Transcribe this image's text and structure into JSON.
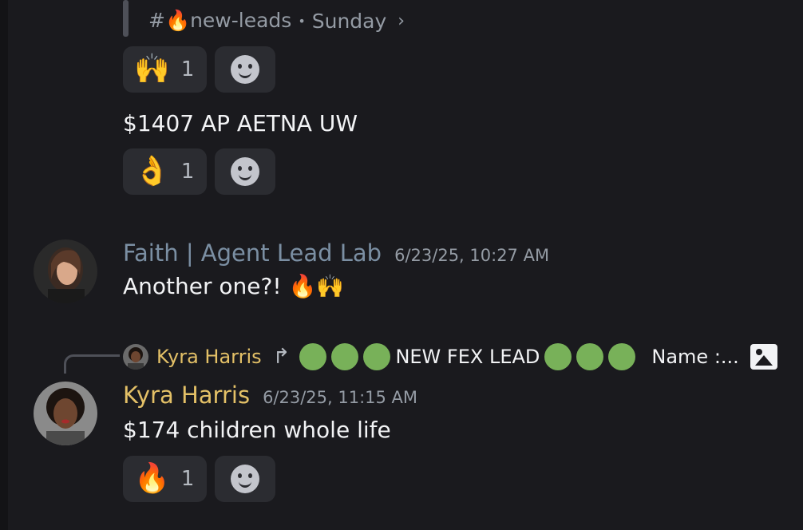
{
  "forwarded": {
    "channel": "#🔥new-leads",
    "separator": "•",
    "day": "Sunday",
    "chevron": "›"
  },
  "reactions_top": {
    "emoji": "🙌",
    "count": "1"
  },
  "message_top": {
    "text": "$1407 AP AETNA UW"
  },
  "reactions_ok": {
    "emoji": "👌",
    "count": "1"
  },
  "faith_message": {
    "author": "Faith | Agent Lead Lab",
    "author_color": "#7b8fa3",
    "timestamp": "6/23/25, 10:27 AM",
    "text": "Another one?! 🔥🙌"
  },
  "reply": {
    "author": "Kyra Harris",
    "arrow": "↱",
    "text": "NEW FEX LEAD",
    "tail": "Name :...",
    "dot_color": "#78b159"
  },
  "kyra_message": {
    "author": "Kyra Harris",
    "author_color": "#e3c067",
    "timestamp": "6/23/25, 11:15 AM",
    "text": "$174 children whole life"
  },
  "reactions_fire": {
    "emoji": "🔥",
    "count": "1"
  }
}
